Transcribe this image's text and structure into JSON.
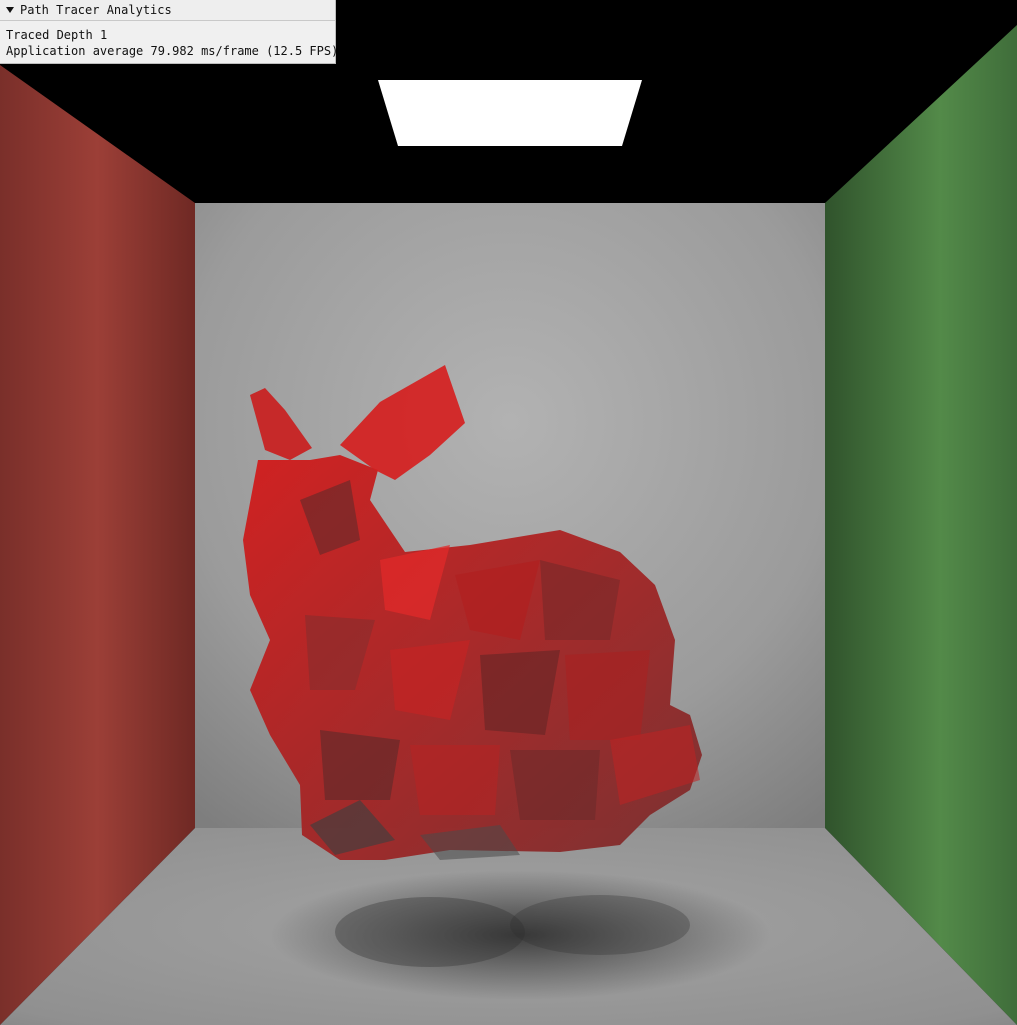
{
  "overlay": {
    "title": "Path Tracer Analytics",
    "traced_depth_label": "Traced Depth",
    "traced_depth_value": "1",
    "app_average": "Application average 79.982 ms/frame (12.5 FPS)",
    "icon": "triangle-down-icon"
  },
  "scene": {
    "left_wall_color": "#8f3b34",
    "right_wall_color": "#4d8444",
    "back_wall_color": "#9f9f9f",
    "floor_color": "#a0a0a0",
    "ceiling_color": "#000000",
    "light_color": "#ffffff",
    "bunny_color": "#d61f1f"
  }
}
